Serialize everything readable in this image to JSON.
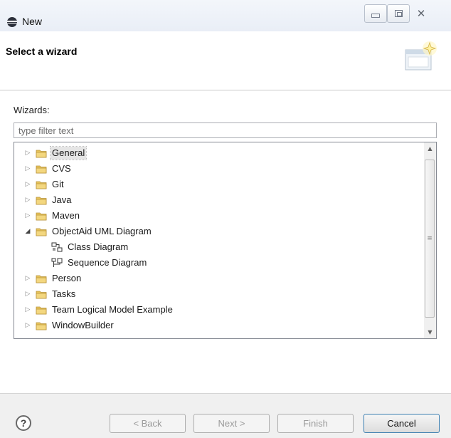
{
  "window": {
    "title": "New"
  },
  "header": {
    "title": "Select a wizard"
  },
  "wizards_label": "Wizards:",
  "filter": {
    "placeholder": "type filter text",
    "value": ""
  },
  "tree": {
    "items": [
      {
        "label": "General",
        "type": "folder",
        "expanded": false,
        "selected": true
      },
      {
        "label": "CVS",
        "type": "folder",
        "expanded": false
      },
      {
        "label": "Git",
        "type": "folder",
        "expanded": false
      },
      {
        "label": "Java",
        "type": "folder",
        "expanded": false
      },
      {
        "label": "Maven",
        "type": "folder",
        "expanded": false
      },
      {
        "label": "ObjectAid UML Diagram",
        "type": "folder",
        "expanded": true
      },
      {
        "label": "Class Diagram",
        "type": "leaf",
        "icon": "class-diagram-icon"
      },
      {
        "label": "Sequence Diagram",
        "type": "leaf",
        "icon": "sequence-diagram-icon"
      },
      {
        "label": "Person",
        "type": "folder",
        "expanded": false
      },
      {
        "label": "Tasks",
        "type": "folder",
        "expanded": false
      },
      {
        "label": "Team Logical Model Example",
        "type": "folder",
        "expanded": false
      },
      {
        "label": "WindowBuilder",
        "type": "folder",
        "expanded": false
      }
    ]
  },
  "buttons": {
    "help": "?",
    "back": "< Back",
    "next": "Next >",
    "finish": "Finish",
    "cancel": "Cancel"
  },
  "colors": {
    "folder": "#e8c45a",
    "accent": "#3c7fb1"
  }
}
